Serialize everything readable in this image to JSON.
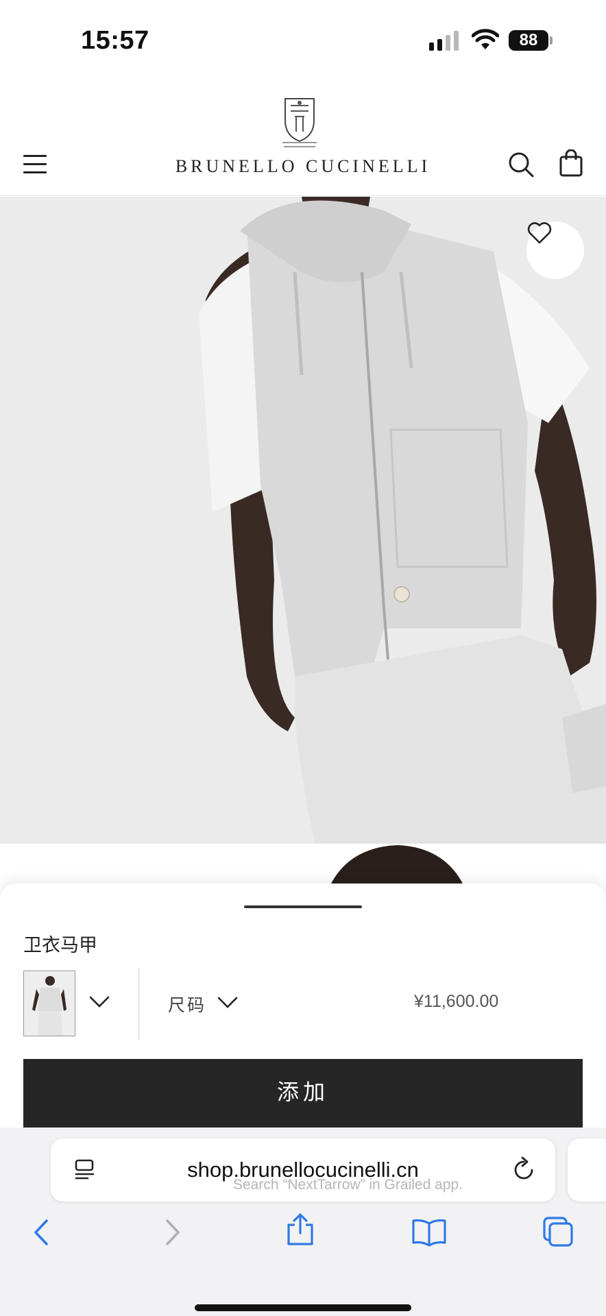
{
  "status_bar": {
    "time": "15:57",
    "battery": "88"
  },
  "header": {
    "brand": "BRUNELLO CUCINELLI",
    "icons": [
      "menu-icon",
      "brand-crest-logo",
      "search-icon",
      "shopping-bag-icon"
    ]
  },
  "product_image": {
    "description_icons": [
      "heart-icon"
    ],
    "favorite_icon": "heart-icon"
  },
  "sheet": {
    "product_name": "卫衣马甲",
    "size_label": "尺码",
    "price": "¥11,600.00",
    "add_button": "添加"
  },
  "browser": {
    "url": "shop.brunellocucinelli.cn",
    "watermark": "Search “NextTarrow” in Grailed app.",
    "toolbar": [
      "back-icon",
      "forward-icon",
      "share-icon",
      "bookmarks-icon",
      "tabs-icon"
    ]
  },
  "colors": {
    "button_bg": "#262626",
    "image_bg": "#ebebeb",
    "accent_blue": "#2f7ae5"
  }
}
